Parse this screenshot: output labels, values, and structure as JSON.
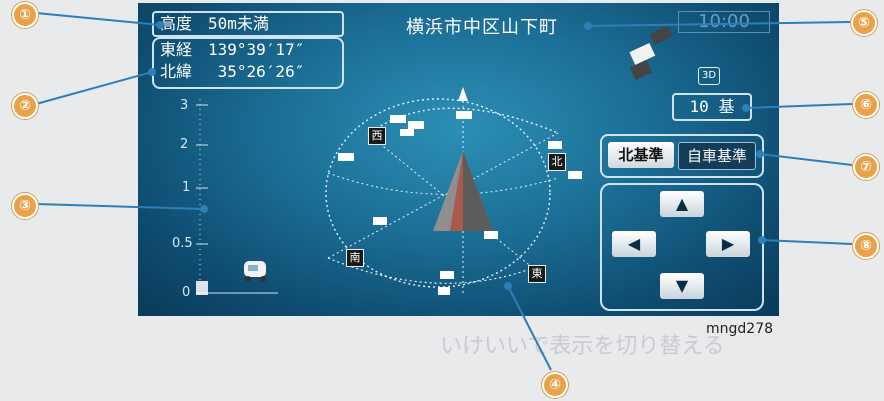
{
  "header": {
    "altitude": "高度　50m未満",
    "longitude": "東経　139°39′17″",
    "latitude": "北緯　 35°26′26″",
    "location": "横浜市中区山下町",
    "time": "10:00"
  },
  "altitude_scale": {
    "labels": [
      "3",
      "2",
      "1",
      "0.5",
      "0"
    ]
  },
  "status": {
    "mode_badge": "3D",
    "satellite_count": "10 基"
  },
  "compass": {
    "west": "西",
    "north": "北",
    "south": "南",
    "east": "東"
  },
  "reference_buttons": {
    "north_up": "北基準",
    "heading_up": "自車基準"
  },
  "arrow_buttons": {
    "up": "▲",
    "left": "◀",
    "right": "▶",
    "down": "▼"
  },
  "callouts": [
    "①",
    "②",
    "③",
    "④",
    "⑤",
    "⑥",
    "⑦",
    "⑧"
  ],
  "figure_caption": "mngd278",
  "colors": {
    "screen_center": "#2c8fb6",
    "screen_edge": "#0a3a59",
    "callout": "#e8a24a",
    "leader_line": "#2d7fb8"
  }
}
